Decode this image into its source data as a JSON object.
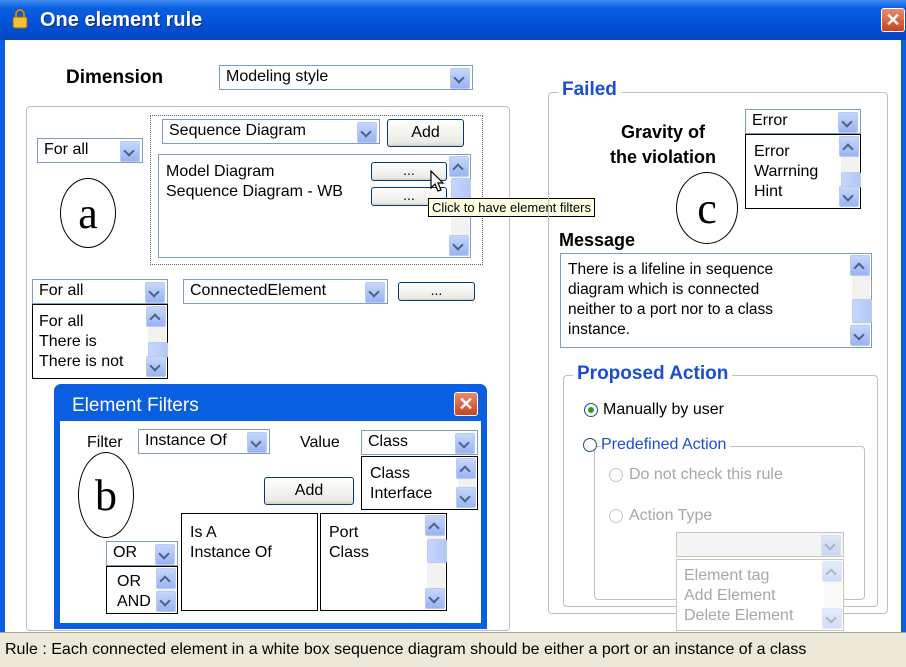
{
  "window": {
    "title": "One element rule"
  },
  "dimension": {
    "label": "Dimension",
    "value": "Modeling style"
  },
  "scope": {
    "quantifier": "For all",
    "diagram_type": "Sequence Diagram",
    "add_label": "Add",
    "diagrams": [
      "Model Diagram",
      "Sequence Diagram - WB"
    ],
    "filter_button": "...",
    "tooltip": "Click to have element filters"
  },
  "connected": {
    "quantifier": "For all",
    "quantifier_options": [
      "For all",
      "There is",
      "There is not"
    ],
    "element": "ConnectedElement",
    "button": "..."
  },
  "element_filters": {
    "title": "Element Filters",
    "filter_label": "Filter",
    "filter_value": "Instance Of",
    "value_label": "Value",
    "value_value": "Class",
    "value_options": [
      "Class",
      "Interface"
    ],
    "add_label": "Add",
    "operator": "OR",
    "operator_options": [
      "OR",
      "AND"
    ],
    "filters": [
      "Is A",
      "Instance Of"
    ],
    "values": [
      "Port",
      "Class"
    ]
  },
  "markers": {
    "a": "a",
    "b": "b",
    "c": "c"
  },
  "failed": {
    "legend": "Failed",
    "gravity_label": "Gravity of the violation",
    "gravity_label_line1": "Gravity of",
    "gravity_label_line2": "the violation",
    "gravity_value": "Error",
    "gravity_options": [
      "Error",
      "Warrning",
      "Hint"
    ],
    "message_label": "Message",
    "message_lines": [
      "There is a lifeline in sequence",
      "diagram which is connected",
      "neither to a port nor to a class",
      "instance."
    ]
  },
  "proposed_action": {
    "legend": "Proposed Action",
    "manual": "Manually by user",
    "predefined": "Predefined Action",
    "do_not_check": "Do not check this rule",
    "action_type": "Action Type",
    "action_type_options": [
      "Element tag",
      "Add Element",
      "Delete Element"
    ]
  },
  "status": {
    "text": "Rule : Each connected element in a white box sequence diagram should be either a port or an instance of a class"
  },
  "colors": {
    "title_bar": "#0a5fe0",
    "legend_blue": "#1a4ed2",
    "tooltip_bg": "#ffffe1"
  }
}
